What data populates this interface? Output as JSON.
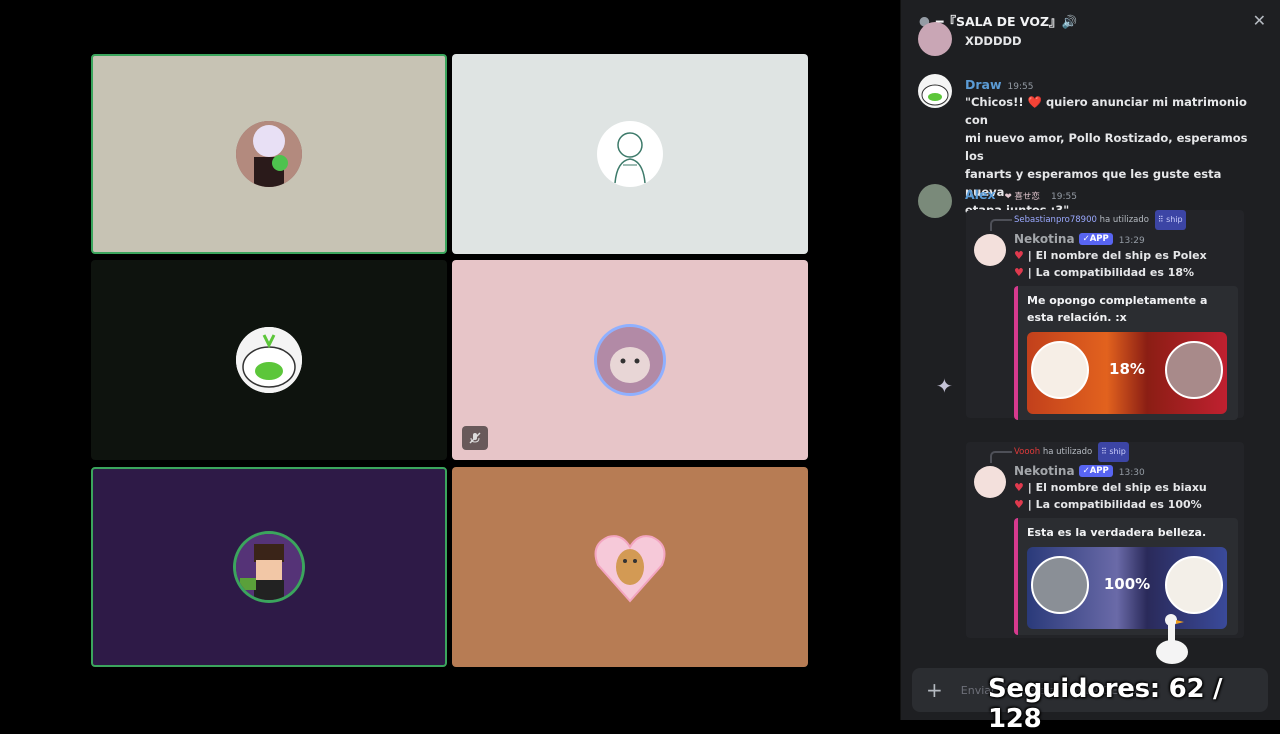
{
  "channel": {
    "title": "━『SALA DE VOZ』🔊"
  },
  "tiles": [
    {
      "bg": "#c7c3b4",
      "speaking": true,
      "avatar": "chibi-avatar"
    },
    {
      "bg": "#dfe4e3",
      "speaking": false,
      "avatar": "sketch-avatar"
    },
    {
      "bg": "#0e130e",
      "speaking": false,
      "avatar": "onion-avatar"
    },
    {
      "bg": "#e7c5c8",
      "speaking": false,
      "avatar": "cat-avatar",
      "muted": true
    },
    {
      "bg": "#2e1a47",
      "speaking": true,
      "avatar": "pixel-avatar"
    },
    {
      "bg": "#b77c54",
      "speaking": false,
      "avatar": "heart-cat-avatar"
    }
  ],
  "messages": {
    "prev_text": "XDDDDD",
    "draw": {
      "username": "Draw",
      "time": "19:55",
      "text_1": "\"Chicos!! ❤️ quiero anunciar mi matrimonio con",
      "text_2": "mi nuevo amor, Pollo Rostizado, esperamos los",
      "text_3": "fanarts y esperamos que les guste esta nueva",
      "text_4": "etapa juntos :3\""
    },
    "alex": {
      "username": "Alex",
      "badge": "❤ 喜せ恋",
      "time": "19:55"
    },
    "bot1": {
      "reply_user": "Sebastianpro78900",
      "reply_action": "ha utilizado",
      "reply_cmd": "⠿ ship",
      "name": "Nekotina",
      "app": "✓APP",
      "time": "13:29",
      "line1": "| El nombre del ship es ",
      "line1_b": "Polex",
      "line2": "| La compatibilidad es ",
      "line2_b": "18%",
      "embed": "Me opongo completamente a esta relación. :x",
      "percent": "18%"
    },
    "bot2": {
      "reply_user": "Voooh",
      "reply_action": "ha utilizado",
      "reply_cmd": "⠿ ship",
      "name": "Nekotina",
      "app": "✓APP",
      "time": "13:30",
      "line1": "| El nombre del ship es ",
      "line1_b": "biaxu",
      "line2": "| La compatibilidad es ",
      "line2_b": "100%",
      "embed": "Esta es la verdadera belleza.",
      "percent": "100%"
    }
  },
  "composer": {
    "placeholder": "Enviar mensaje a 『SALA DE VOZ』"
  },
  "overlay": {
    "followers": "Seguidores: 62 / 128"
  },
  "colors": {
    "speaking": "#3ba55d",
    "link_name": "#5b9bd5",
    "embed_accent": "#d63a8e"
  }
}
